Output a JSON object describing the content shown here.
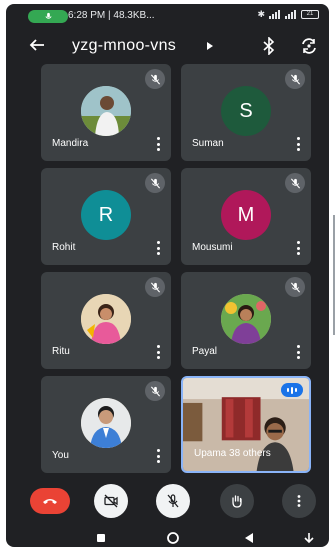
{
  "status_bar": {
    "time_data": "6:28 PM | 48.3KB...",
    "battery": "21"
  },
  "header": {
    "meeting_code": "yzg-mnoo-vns"
  },
  "participants": [
    {
      "name": "Mandira",
      "avatar_type": "photo",
      "muted": true
    },
    {
      "name": "Suman",
      "avatar_type": "initial",
      "initial": "S",
      "avatar_color": "#1e5a3c",
      "muted": true
    },
    {
      "name": "Rohit",
      "avatar_type": "initial",
      "initial": "R",
      "avatar_color": "#0f8e96",
      "muted": true
    },
    {
      "name": "Mousumi",
      "avatar_type": "initial",
      "initial": "M",
      "avatar_color": "#b0185a",
      "muted": true
    },
    {
      "name": "Ritu",
      "avatar_type": "photo",
      "muted": true
    },
    {
      "name": "Payal",
      "avatar_type": "photo",
      "muted": true
    },
    {
      "name": "You",
      "avatar_type": "photo",
      "muted": true
    },
    {
      "name": "Upama  38 others",
      "avatar_type": "video",
      "speaking": true
    }
  ],
  "colors": {
    "background": "#202124",
    "tile": "#3c4043",
    "end_call": "#ea4335",
    "active_border": "#8ab4f8",
    "active_badge": "#1a73e8"
  }
}
